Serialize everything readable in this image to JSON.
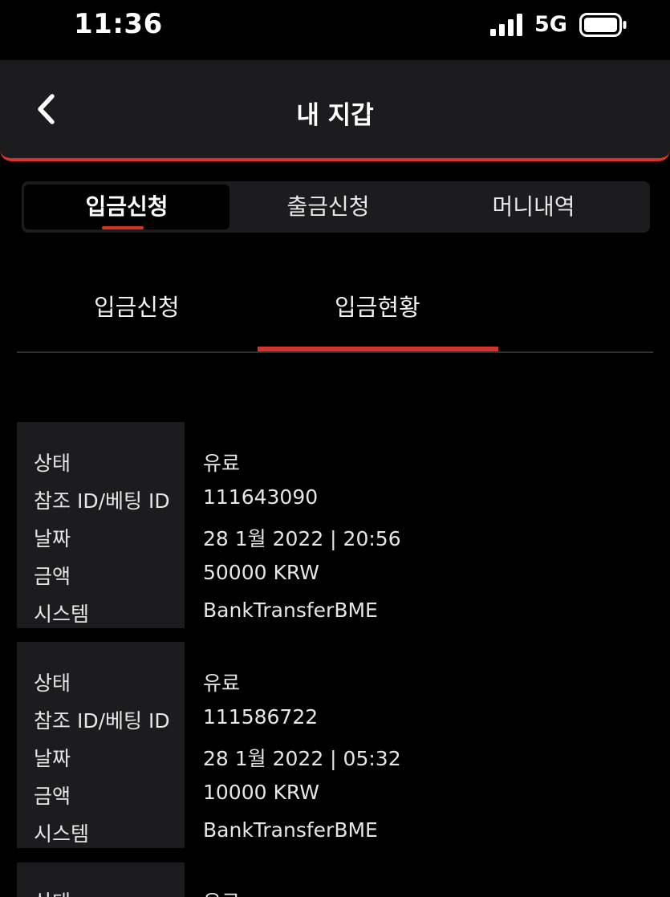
{
  "status_bar": {
    "time": "11:36",
    "network": "5G"
  },
  "header": {
    "title": "내 지갑",
    "back_icon": "chevron-left-icon"
  },
  "segments": [
    {
      "label": "입금신청",
      "active": true
    },
    {
      "label": "출금신청",
      "active": false
    },
    {
      "label": "머니내역",
      "active": false
    }
  ],
  "subtabs": [
    {
      "label": "입금신청",
      "active": false
    },
    {
      "label": "입금현황",
      "active": true
    }
  ],
  "records": [
    {
      "rows": [
        {
          "label": "상태",
          "value": "유료"
        },
        {
          "label": "참조 ID/베팅 ID",
          "value": "111643090"
        },
        {
          "label": "날짜",
          "value": "28 1월 2022 | 20:56"
        },
        {
          "label": "금액",
          "value": "50000 KRW"
        },
        {
          "label": "시스템",
          "value": "BankTransferBME"
        }
      ]
    },
    {
      "rows": [
        {
          "label": "상태",
          "value": "유료"
        },
        {
          "label": "참조 ID/베팅 ID",
          "value": "111586722"
        },
        {
          "label": "날짜",
          "value": "28 1월 2022 | 05:32"
        },
        {
          "label": "금액",
          "value": "10000 KRW"
        },
        {
          "label": "시스템",
          "value": "BankTransferBME"
        }
      ]
    },
    {
      "rows": [
        {
          "label": "상태",
          "value": "유료"
        }
      ]
    }
  ],
  "colors": {
    "accent": "#d8322d",
    "panel": "#1c1c1e",
    "background": "#000000"
  }
}
